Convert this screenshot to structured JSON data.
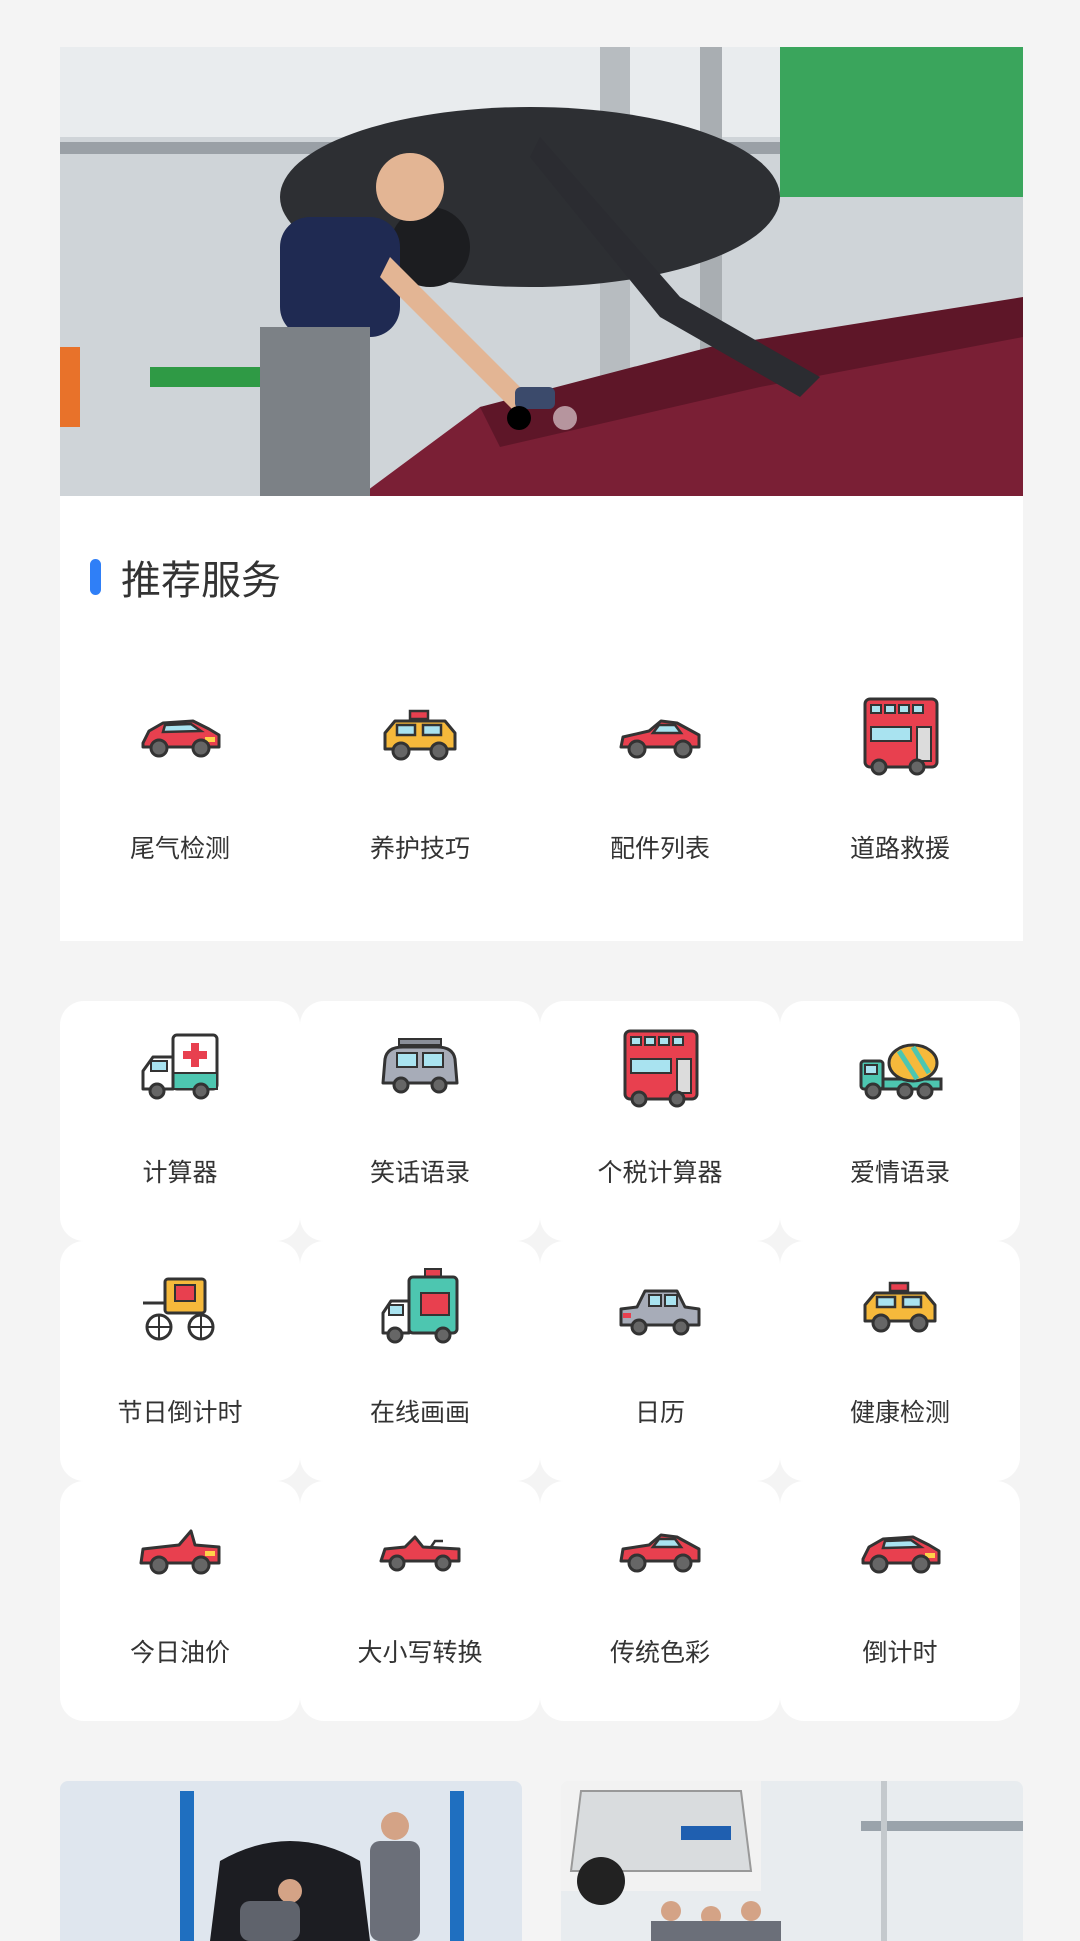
{
  "banner": {
    "image": "mechanic-inspecting-car-photo",
    "slide_count": 2,
    "active_slide": 1
  },
  "recommended": {
    "title": "推荐服务",
    "accent_color": "#2f7ff7",
    "items": [
      {
        "label": "尾气检测",
        "icon": "sedan-red-icon"
      },
      {
        "label": "养护技巧",
        "icon": "taxi-yellow-icon"
      },
      {
        "label": "配件列表",
        "icon": "sports-car-red-icon"
      },
      {
        "label": "道路救援",
        "icon": "double-decker-bus-icon"
      }
    ]
  },
  "grid": {
    "items": [
      {
        "label": "计算器",
        "icon": "ambulance-icon"
      },
      {
        "label": "笑话语录",
        "icon": "camper-van-icon"
      },
      {
        "label": "个税计算器",
        "icon": "double-decker-bus-icon"
      },
      {
        "label": "爱情语录",
        "icon": "cement-mixer-truck-icon"
      },
      {
        "label": "节日倒计时",
        "icon": "carriage-icon"
      },
      {
        "label": "在线画画",
        "icon": "delivery-truck-icon"
      },
      {
        "label": "日历",
        "icon": "gray-sedan-icon"
      },
      {
        "label": "健康检测",
        "icon": "taxi-yellow-icon"
      },
      {
        "label": "今日油价",
        "icon": "convertible-red-icon"
      },
      {
        "label": "大小写转换",
        "icon": "roadster-red-icon"
      },
      {
        "label": "传统色彩",
        "icon": "sports-car-red-icon"
      },
      {
        "label": "倒计时",
        "icon": "sedan-red-icon"
      }
    ]
  },
  "photos": [
    {
      "image": "mechanics-under-hood-photo"
    },
    {
      "image": "car-lift-workshop-photo"
    }
  ]
}
